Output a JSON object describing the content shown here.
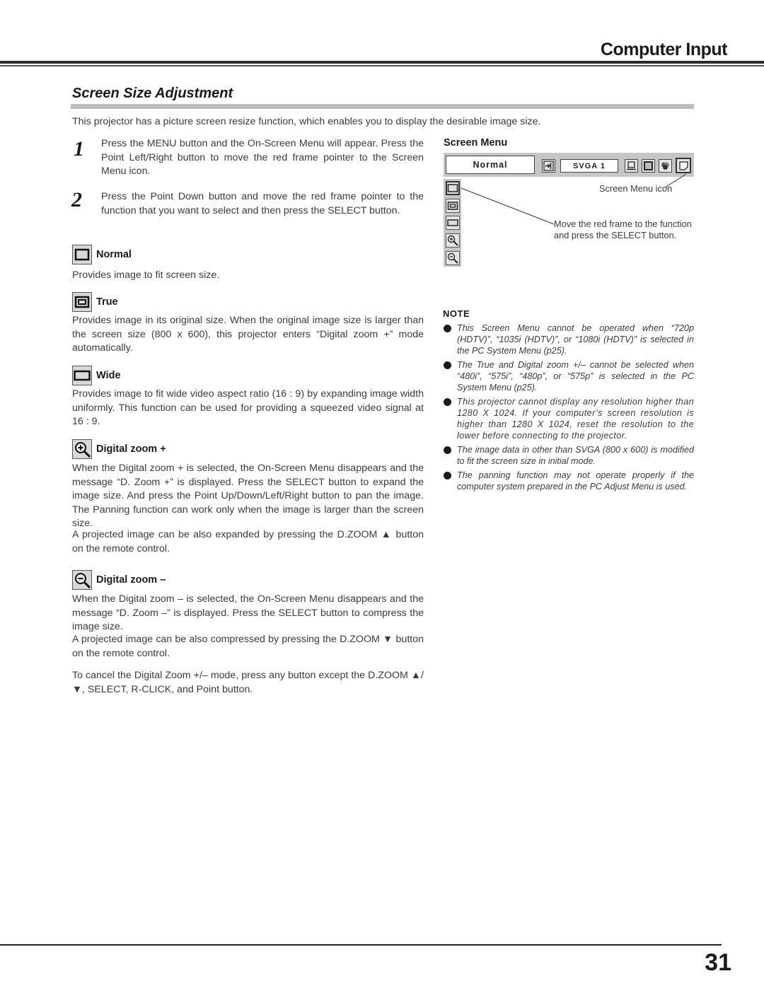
{
  "header": {
    "chapter_title": "Computer Input"
  },
  "section": {
    "title": "Screen Size Adjustment",
    "intro": "This projector has a picture screen resize function, which enables you to display the desirable image size."
  },
  "steps": [
    {
      "number": "1",
      "text": "Press the MENU button and the On-Screen Menu will appear. Press the Point Left/Right button to move the red frame pointer to the Screen Menu icon."
    },
    {
      "number": "2",
      "text": "Press the Point Down button and move the red frame pointer to the function that you want to select and then press the SELECT button."
    }
  ],
  "functions": [
    {
      "icon": "normal-screen-icon",
      "label": "Normal",
      "text": "Provides image to fit screen size."
    },
    {
      "icon": "true-screen-icon",
      "label": "True",
      "text": "Provides image in its original size.  When the original image size is larger than the screen size (800 x 600), this projector enters “Digital zoom +” mode automatically."
    },
    {
      "icon": "wide-screen-icon",
      "label": "Wide",
      "text": "Provides image to fit wide video aspect ratio (16 : 9) by expanding image width uniformly.  This function can be used for providing a squeezed video signal at 16 : 9."
    },
    {
      "icon": "zoom-in-icon",
      "label": "Digital zoom +",
      "text": "When the Digital zoom + is selected, the On-Screen Menu disappears and the message “D. Zoom +” is displayed.  Press the SELECT button to expand the image size.  And press the Point Up/Down/Left/Right button to pan the image.  The Panning function can work only when the image is larger than the screen size.",
      "text2": "A projected image can be also expanded by pressing the D.ZOOM ▲ button on the remote control."
    },
    {
      "icon": "zoom-out-icon",
      "label": "Digital zoom –",
      "text": "When the Digital zoom – is selected, the On-Screen Menu disappears and the message “D. Zoom –” is displayed.  Press the SELECT button to compress the image size.",
      "text2": "A projected image can be also compressed by pressing the D.ZOOM ▼ button on the remote control."
    }
  ],
  "cancel_text": "To cancel the Digital Zoom +/– mode, press any button except the D.ZOOM ▲/▼, SELECT, R-CLICK, and Point button.",
  "screen_menu": {
    "title": "Screen Menu",
    "selected_mode": "Normal",
    "source": "SVGA 1",
    "callout_icon": "Screen Menu icon",
    "callout_frame": "Move the red frame to the function and press the SELECT button."
  },
  "note": {
    "title": "NOTE",
    "items": [
      "This Screen Menu cannot be operated when “720p (HDTV)”, “1035i (HDTV)”, or “1080i (HDTV)” is selected in the PC System Menu  (p25).",
      "The True and Digital zoom +/– cannot be selected when “480i”, “575i”, “480p”, or “575p” is selected in the PC System Menu  (p25).",
      "This projector cannot display any resolution higher than 1280 X 1024.  If your computer’s screen resolution is higher than 1280 X 1024, reset the resolution to the lower before connecting to the projector.",
      "The image data in other than SVGA (800 x 600) is modified to fit the screen size in initial mode.",
      "The panning function may not operate properly if the computer system prepared in the PC Adjust Menu is used."
    ]
  },
  "footer": {
    "page_number": "31"
  }
}
